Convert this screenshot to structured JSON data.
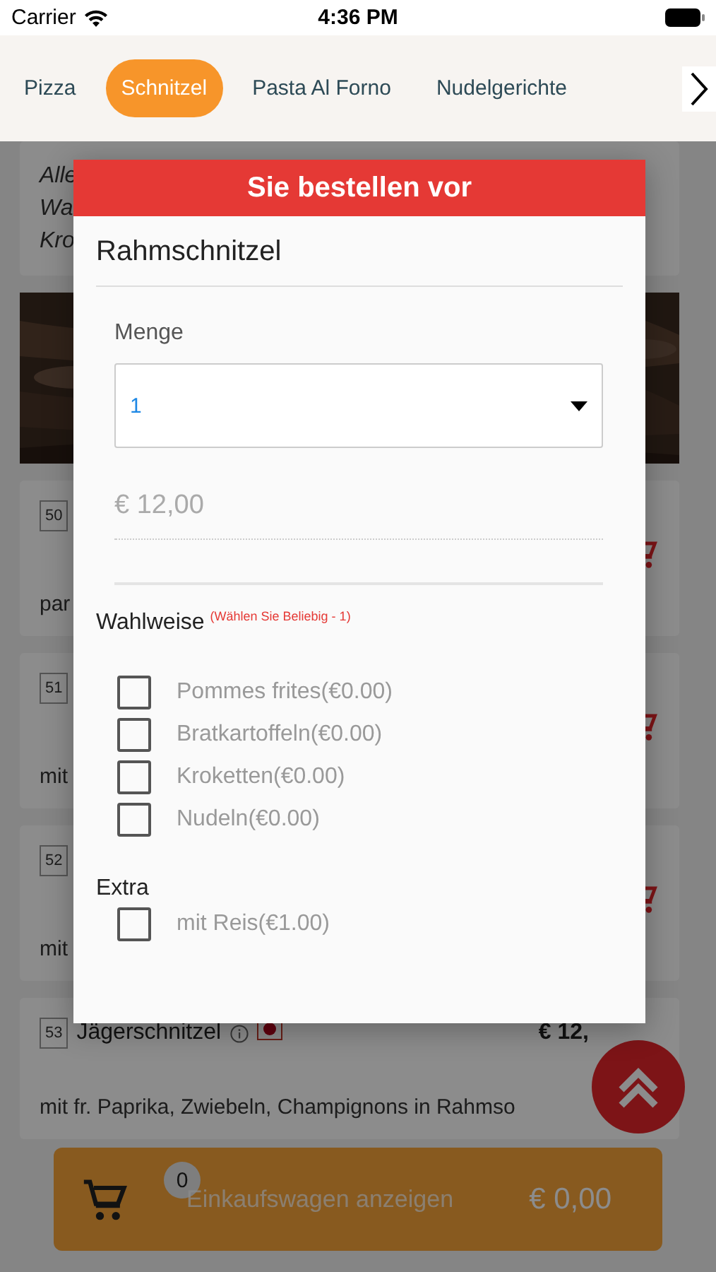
{
  "status_bar": {
    "carrier": "Carrier",
    "time": "4:36 PM"
  },
  "tabs": [
    {
      "label": "Pizza",
      "selected": false
    },
    {
      "label": "Schnitzel",
      "selected": true
    },
    {
      "label": "Pasta Al Forno",
      "selected": false
    },
    {
      "label": "Nudelgerichte",
      "selected": false
    }
  ],
  "intro_fragments": [
    "Alle",
    "Wa",
    "Kro"
  ],
  "items": [
    {
      "number": "50",
      "description": "par"
    },
    {
      "number": "51",
      "description": "mit"
    },
    {
      "number": "52",
      "description": "mit"
    },
    {
      "number": "53",
      "name": "Jägerschnitzel",
      "price": "€ 12,",
      "description": "mit fr. Paprika, Zwiebeln, Champignons in Rahmso"
    }
  ],
  "cart": {
    "count": "0",
    "label": "Einkaufswagen anzeigen",
    "total": "€ 0,00"
  },
  "modal": {
    "title": "Sie bestellen vor",
    "product": "Rahmschnitzel",
    "quantity_label": "Menge",
    "quantity_value": "1",
    "price": "€ 12,00",
    "groups": [
      {
        "title": "Wahlweise",
        "hint": "(Wählen Sie Beliebig - 1)",
        "options": [
          {
            "label": "Pommes frites(€0.00)",
            "checked": false
          },
          {
            "label": "Bratkartoffeln(€0.00)",
            "checked": false
          },
          {
            "label": "Kroketten(€0.00)",
            "checked": false
          },
          {
            "label": "Nudeln(€0.00)",
            "checked": false
          }
        ]
      },
      {
        "title": "Extra",
        "options": [
          {
            "label": "mit Reis(€1.00)",
            "checked": false
          }
        ]
      }
    ]
  }
}
